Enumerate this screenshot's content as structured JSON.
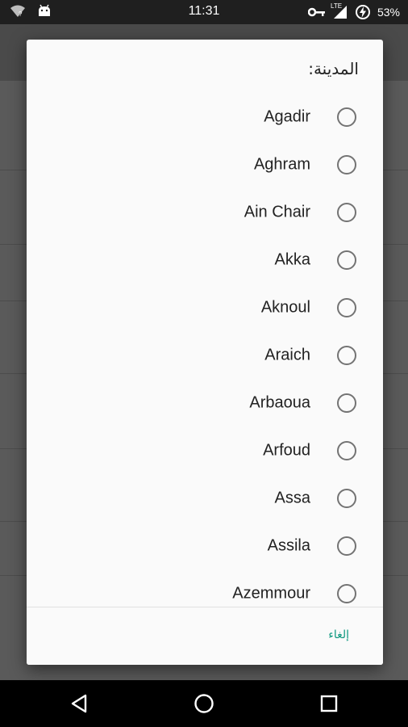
{
  "status_bar": {
    "time": "11:31",
    "network_badge": "LTE",
    "battery": "53%"
  },
  "dialog": {
    "title": "المدينة:",
    "options": [
      {
        "label": "Agadir",
        "selected": false
      },
      {
        "label": "Aghram",
        "selected": false
      },
      {
        "label": "Ain Chair",
        "selected": false
      },
      {
        "label": "Akka",
        "selected": false
      },
      {
        "label": "Aknoul",
        "selected": false
      },
      {
        "label": "Araich",
        "selected": false
      },
      {
        "label": "Arbaoua",
        "selected": false
      },
      {
        "label": "Arfoud",
        "selected": false
      },
      {
        "label": "Assa",
        "selected": false
      },
      {
        "label": "Assila",
        "selected": false
      },
      {
        "label": "Azemmour",
        "selected": false
      }
    ],
    "cancel_label": "إلغاء"
  },
  "colors": {
    "accent": "#109980",
    "scrim": "#5b5b5b",
    "dialog_bg": "#fafafa"
  },
  "icons": {
    "status_left": [
      "wifi-icon",
      "android-icon"
    ],
    "status_right": [
      "key-icon",
      "signal-icon",
      "battery-saver-icon"
    ],
    "nav": [
      "back-icon",
      "home-icon",
      "recents-icon"
    ]
  }
}
